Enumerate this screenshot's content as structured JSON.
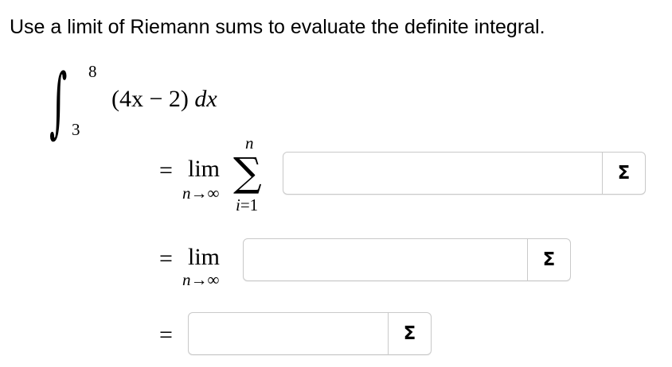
{
  "prompt": "Use a limit of Riemann sums to evaluate the definite integral.",
  "integral": {
    "upper": "8",
    "lower": "3",
    "integrand": "(4x − 2)",
    "differential": "dx"
  },
  "steps": [
    {
      "equals": "=",
      "lim": "lim",
      "lim_sub_var": "n",
      "lim_sub_arrow": "→∞",
      "sigma_upper": "n",
      "sigma_lower_var": "i",
      "sigma_lower_rest": "=1",
      "answer_value": "",
      "button_icon": "Σ"
    },
    {
      "equals": "=",
      "lim": "lim",
      "lim_sub_var": "n",
      "lim_sub_arrow": "→∞",
      "answer_value": "",
      "button_icon": "Σ"
    },
    {
      "equals": "=",
      "answer_value": "",
      "button_icon": "Σ"
    }
  ]
}
